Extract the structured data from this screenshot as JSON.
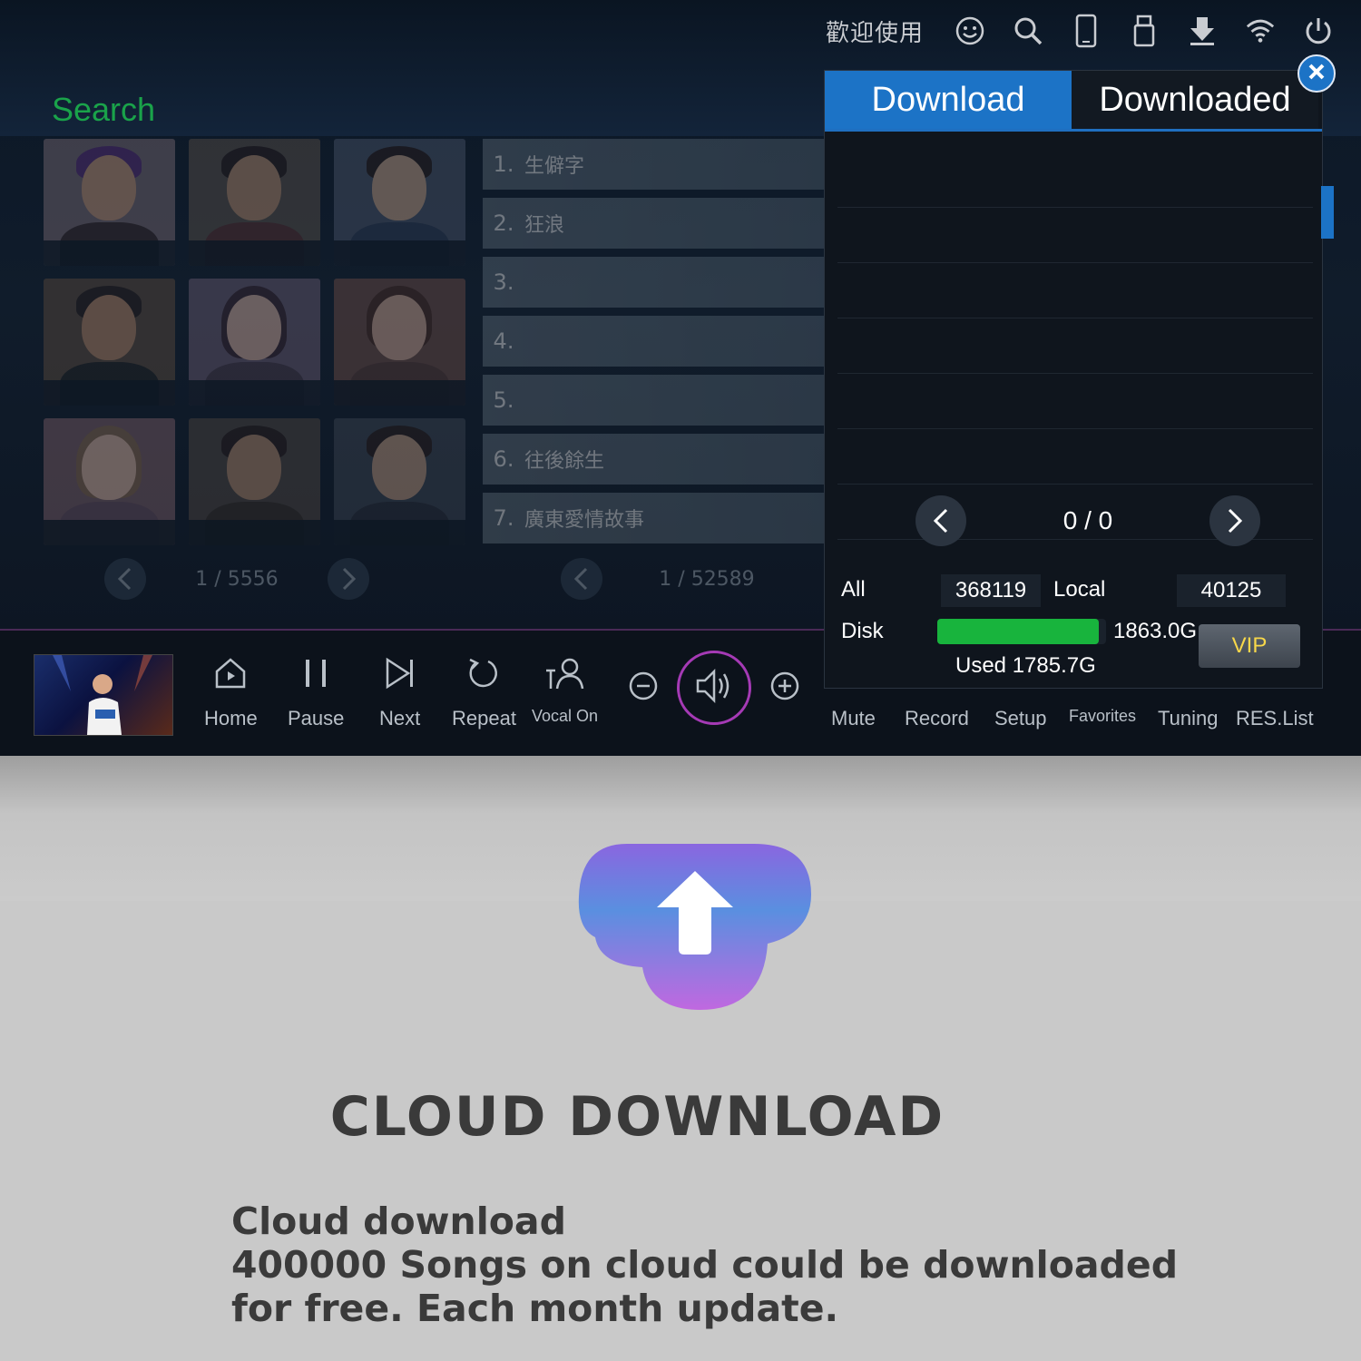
{
  "status_bar": {
    "welcome": "歡迎使用",
    "icons": [
      "smile-icon",
      "search-icon",
      "phone-icon",
      "usb-icon",
      "download-arrow-icon",
      "wifi-icon",
      "power-icon"
    ]
  },
  "search": {
    "label": "Search"
  },
  "artists": [
    "",
    "",
    "",
    "",
    "",
    "",
    "",
    "",
    ""
  ],
  "artist_pager": {
    "text": "1 / 5556"
  },
  "songs": [
    {
      "num": "1.",
      "title": "生僻字"
    },
    {
      "num": "2.",
      "title": "狂浪"
    },
    {
      "num": "3.",
      "title": ""
    },
    {
      "num": "4.",
      "title": ""
    },
    {
      "num": "5.",
      "title": ""
    },
    {
      "num": "6.",
      "title": "往後餘生"
    },
    {
      "num": "7.",
      "title": "廣東愛情故事"
    }
  ],
  "song_pager": {
    "text": "1 / 52589"
  },
  "download_panel": {
    "tabs": [
      {
        "label": "Download",
        "active": true
      },
      {
        "label": "Downloaded",
        "active": false
      }
    ],
    "pager_count": "0 / 0",
    "stats": {
      "all_label": "All",
      "all_value": "368119",
      "local_label": "Local",
      "local_value": "40125",
      "disk_label": "Disk",
      "disk_total": "1863.0G",
      "disk_used": "Used 1785.7G",
      "disk_used_fraction": 0.958
    },
    "vip_label": "VIP"
  },
  "controls": {
    "home": "Home",
    "pause": "Pause",
    "next": "Next",
    "repeat": "Repeat",
    "vocal": "Vocal On",
    "mute": "Mute",
    "record": "Record",
    "setup": "Setup",
    "favorites": "Favorites",
    "tuning": "Tuning",
    "res_list": "RES.List"
  },
  "promo": {
    "headline": "CLOUD DOWNLOAD",
    "line1": "Cloud download",
    "line2": "400000  Songs on cloud could be downloaded",
    "line3": "for free. Each month update."
  },
  "colors": {
    "accent_blue": "#1c73c6",
    "search_green": "#1aa34a",
    "disk_green": "#18b43d",
    "vip_gold": "#f7d74a",
    "volume_ring": "#a53ab5"
  }
}
